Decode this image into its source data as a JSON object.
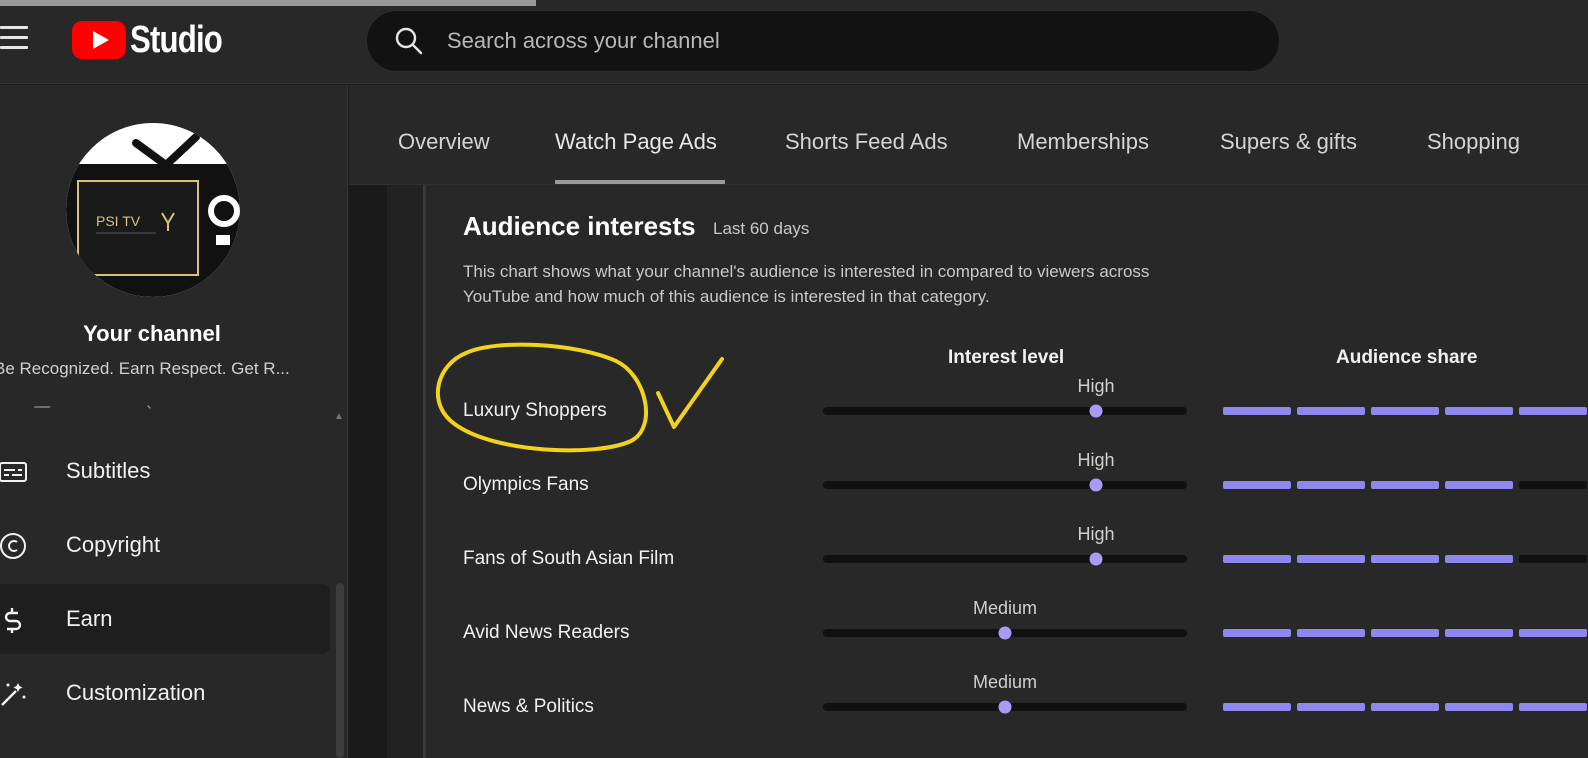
{
  "app": {
    "logo_text": "Studio",
    "search": {
      "placeholder": "Search across your channel"
    }
  },
  "sidebar": {
    "channel": {
      "avatar_brand": "PSI TV",
      "name": "Your channel",
      "tagline": "Be Recognized. Earn Respect. Get R..."
    },
    "items": [
      {
        "label": "Subtitles",
        "icon": "subtitles-icon",
        "active": false
      },
      {
        "label": "Copyright",
        "icon": "copyright-icon",
        "active": false
      },
      {
        "label": "Earn",
        "icon": "dollar-icon",
        "active": true
      },
      {
        "label": "Customization",
        "icon": "magic-wand-icon",
        "active": false
      }
    ]
  },
  "tabs": [
    {
      "label": "Overview",
      "active": false
    },
    {
      "label": "Watch Page Ads",
      "active": true
    },
    {
      "label": "Shorts Feed Ads",
      "active": false
    },
    {
      "label": "Memberships",
      "active": false
    },
    {
      "label": "Supers & gifts",
      "active": false
    },
    {
      "label": "Shopping",
      "active": false
    }
  ],
  "audience": {
    "title": "Audience interests",
    "period": "Last 60 days",
    "description": "This chart shows what your channel's audience is interested in compared to viewers across YouTube and how much of this audience is interested in that category.",
    "col_interest": "Interest level",
    "col_share": "Audience share",
    "rows": [
      {
        "label": "Luxury Shoppers",
        "level": "High",
        "interest": 0.75,
        "share_filled": 5
      },
      {
        "label": "Olympics Fans",
        "level": "High",
        "interest": 0.75,
        "share_filled": 4
      },
      {
        "label": "Fans of South Asian Film",
        "level": "High",
        "interest": 0.75,
        "share_filled": 4
      },
      {
        "label": "Avid News Readers",
        "level": "Medium",
        "interest": 0.5,
        "share_filled": 5
      },
      {
        "label": "News & Politics",
        "level": "Medium",
        "interest": 0.5,
        "share_filled": 5
      }
    ]
  },
  "colors": {
    "accent": "#8f86ee",
    "brand_red": "#ff0000",
    "annotation": "#f2d31b"
  }
}
